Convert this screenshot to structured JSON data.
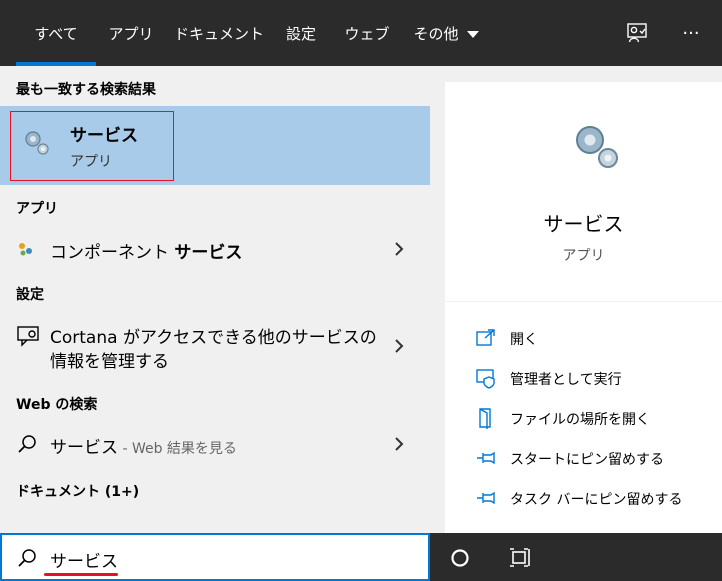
{
  "tabs": [
    {
      "label": "すべて",
      "active": true
    },
    {
      "label": "アプリ"
    },
    {
      "label": "ドキュメント"
    },
    {
      "label": "設定"
    },
    {
      "label": "ウェブ"
    },
    {
      "label": "その他"
    }
  ],
  "top_icons": [
    "feedback-icon",
    "more-options-icon"
  ],
  "top_icons_more_glyph": "···",
  "best_match": {
    "heading": "最も一致する検索結果",
    "title": "サービス",
    "subtitle": "アプリ",
    "icon": "services-gear-icon"
  },
  "apps": {
    "heading": "アプリ",
    "items": [
      {
        "prefix": "コンポーネント ",
        "bold": "サービス",
        "icon": "component-services-icon"
      }
    ]
  },
  "settings": {
    "heading": "設定",
    "items": [
      {
        "line1": "Cortana がアクセスできる他のサービスの",
        "line2": "情報を管理する",
        "icon": "cortana-settings-icon"
      }
    ]
  },
  "web": {
    "heading": "Web の検索",
    "items": [
      {
        "query": "サービス",
        "suffix": " - Web 結果を見る",
        "icon": "search-icon"
      }
    ]
  },
  "documents": {
    "heading": "ドキュメント (1+)"
  },
  "preview": {
    "title": "サービス",
    "subtitle": "アプリ",
    "icon": "services-gear-icon",
    "actions": [
      {
        "label": "開く",
        "icon": "open-icon"
      },
      {
        "label": "管理者として実行",
        "icon": "run-as-admin-icon"
      },
      {
        "label": "ファイルの場所を開く",
        "icon": "file-location-icon"
      },
      {
        "label": "スタートにピン留めする",
        "icon": "pin-icon"
      },
      {
        "label": "タスク バーにピン留めする",
        "icon": "pin-icon"
      }
    ]
  },
  "search": {
    "value": "サービス"
  },
  "taskbar_icons": [
    "cortana-circle-icon",
    "task-view-icon"
  ],
  "colors": {
    "accent": "#0078d7",
    "selection": "#a8cbe9",
    "highlight_border": "#e81123",
    "dark": "#2b2b2b"
  }
}
